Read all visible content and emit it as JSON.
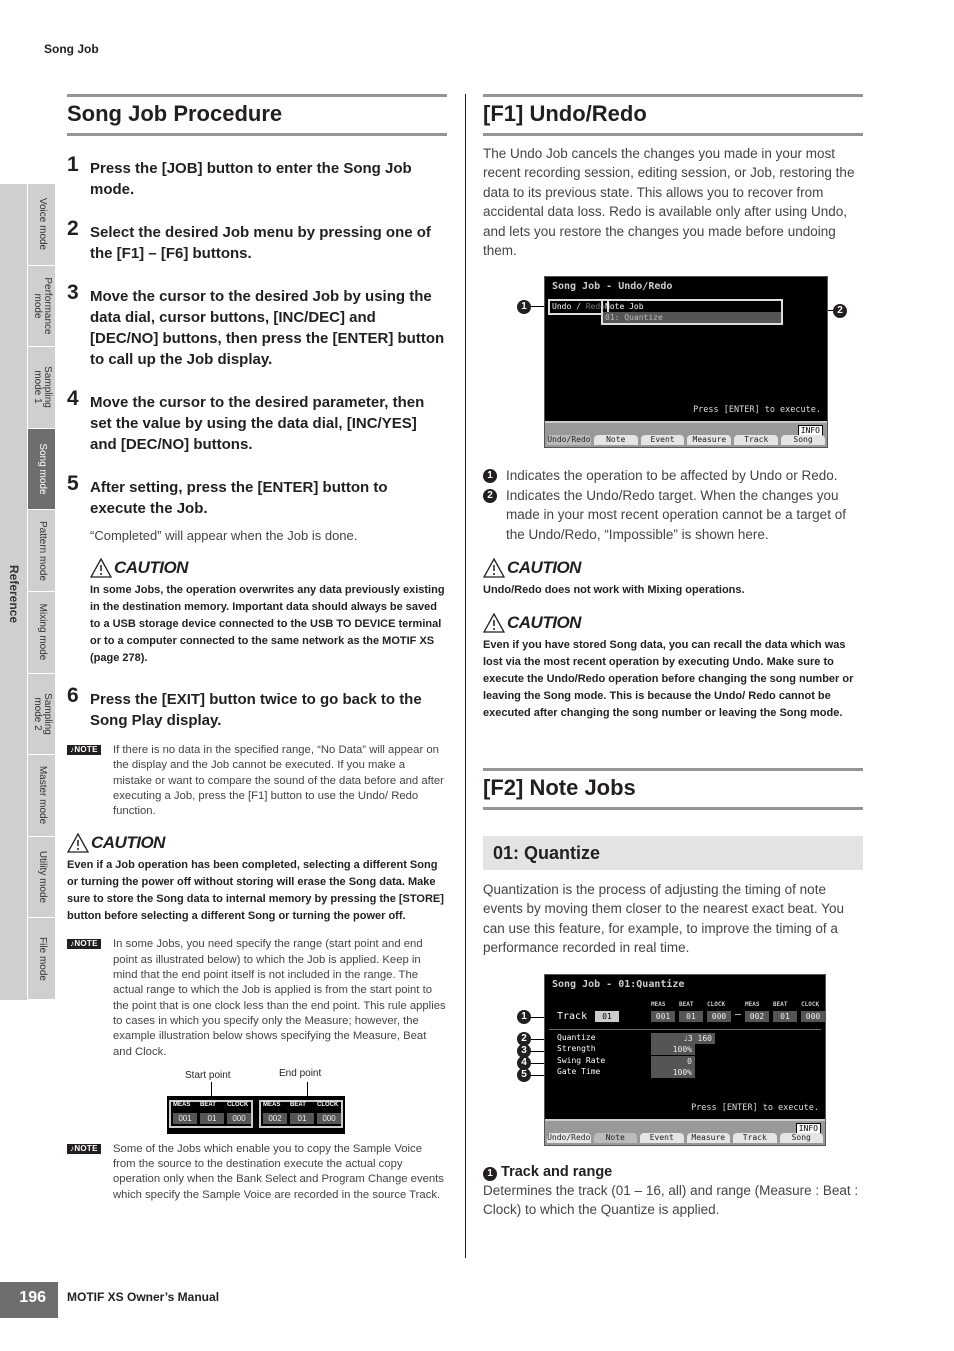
{
  "header": {
    "section": "Song Job"
  },
  "sidebar": {
    "group_label": "Reference",
    "tabs": [
      {
        "label": "Voice mode",
        "active": false
      },
      {
        "label": "Performance\nmode",
        "active": false
      },
      {
        "label": "Sampling\nmode 1",
        "active": false
      },
      {
        "label": "Song mode",
        "active": true
      },
      {
        "label": "Pattern mode",
        "active": false
      },
      {
        "label": "Mixing mode",
        "active": false
      },
      {
        "label": "Sampling\nmode 2",
        "active": false
      },
      {
        "label": "Master mode",
        "active": false
      },
      {
        "label": "Utility mode",
        "active": false
      },
      {
        "label": "File mode",
        "active": false
      }
    ]
  },
  "left": {
    "title": "Song Job Procedure",
    "steps": [
      {
        "num": "1",
        "text": "Press the [JOB] button to enter the Song Job mode."
      },
      {
        "num": "2",
        "text": "Select the desired Job menu by pressing one of the [F1] – [F6] buttons."
      },
      {
        "num": "3",
        "text": "Move the cursor to the desired Job by using the data dial, cursor buttons, [INC/DEC] and [DEC/NO] buttons, then press the [ENTER] button to call up the Job display."
      },
      {
        "num": "4",
        "text": "Move the cursor to the desired parameter, then set the value by using the data dial, [INC/YES] and [DEC/NO] buttons."
      },
      {
        "num": "5",
        "text": "After setting, press the [ENTER] button to execute the Job."
      },
      {
        "num": "6",
        "text": "Press the [EXIT] button twice to go back to the Song Play display."
      }
    ],
    "step5_sub": "“Completed” will appear when the Job is done.",
    "caution_label": "CAUTION",
    "caution1": "In some Jobs, the operation overwrites any data previously existing in the destination memory. Important data should always be saved to a USB storage device connected to the USB TO DEVICE terminal or to a computer connected to the same network as the MOTIF XS (page 278).",
    "note_label": "NOTE",
    "note1": "If there is no data in the specified range, “No Data” will appear on the display and the Job cannot be executed. If you make a mistake or want to compare the sound of the data before and after executing a Job, press the [F1] button to use the Undo/ Redo function.",
    "caution2": "Even if a Job operation has been completed, selecting a different Song or turning the power off without storing will erase the Song data. Make sure to store the Song data to internal memory by pressing the [STORE] button before selecting a different Song or turning the power off.",
    "note2": "In some Jobs, you need specify the range (start point and end point as illustrated below) to which the Job is applied. Keep in mind that the end point itself is not included in the range. The actual range to which the Job is applied is from the start point to the point that is one clock less than the end point. This rule applies to cases in which you specify only the Measure; however, the example illustration below shows specifying the Measure, Beat and Clock.",
    "range_fig": {
      "start_label": "Start point",
      "end_label": "End point",
      "headers": [
        "MEAS",
        "BEAT",
        "CLOCK"
      ],
      "start": [
        "001",
        "01",
        "000"
      ],
      "end": [
        "002",
        "01",
        "000"
      ]
    },
    "note3": "Some of the Jobs which enable you to copy the Sample Voice from the source to the destination execute the actual copy operation only when the Bank Select and Program Change events which specify the Sample Voice are recorded in the source Track."
  },
  "right": {
    "undo_title": "[F1] Undo/Redo",
    "undo_body": "The Undo Job cancels the changes you made in your most recent recording session, editing session, or Job, restoring the data to its previous state. This allows you to recover from accidental data loss. Redo is available only after using Undo, and lets you restore the changes you made before undoing them.",
    "undo_screen": {
      "title": "Song Job - Undo/Redo",
      "undo": "Undo",
      "slash": " / ",
      "redo": "Redo",
      "job_name": "Note Job",
      "job_item": "01: Quantize",
      "press": "Press [ENTER] to execute.",
      "info": "INFO",
      "tabs": [
        "Undo/Redo",
        "Note",
        "Event",
        "Measure",
        "Track",
        "Song"
      ],
      "active_tab": 0
    },
    "undo_callouts": [
      "1",
      "2"
    ],
    "undo_items": [
      {
        "num": "1",
        "text": "Indicates the operation to be affected by Undo or Redo."
      },
      {
        "num": "2",
        "text": "Indicates the Undo/Redo target. When the changes you made in your most recent operation cannot be a target of the Undo/Redo, “Impossible” is shown here."
      }
    ],
    "caution_label": "CAUTION",
    "caution1": "Undo/Redo does not work with Mixing operations.",
    "caution2": "Even if you have stored Song data, you can recall the data which was lost via the most recent operation by executing Undo. Make sure to execute the Undo/Redo operation before changing the song number or leaving the Song mode. This is because the Undo/ Redo cannot be executed after changing the song number or leaving the Song mode.",
    "note_title": "[F2] Note Jobs",
    "quantize_title": "01: Quantize",
    "quantize_body": "Quantization is the process of adjusting the timing of note events by moving them closer to the nearest exact beat. You can use this feature, for example, to improve the timing of a performance recorded in real time.",
    "quantize_screen": {
      "title": "Song Job - 01:Quantize",
      "track_label": "Track",
      "track_value": "01",
      "headers": [
        "MEAS",
        "BEAT",
        "CLOCK"
      ],
      "start": [
        "001",
        "01",
        "000"
      ],
      "end": [
        "002",
        "01",
        "000"
      ],
      "params": [
        {
          "label": "Quantize",
          "value": "♩3 160"
        },
        {
          "label": "Strength",
          "value": "100%"
        },
        {
          "label": "Swing Rate",
          "value": "0"
        },
        {
          "label": "Gate Time",
          "value": "100%"
        }
      ],
      "press": "Press [ENTER] to execute.",
      "info": "INFO",
      "tabs": [
        "Undo/Redo",
        "Note",
        "Event",
        "Measure",
        "Track",
        "Song"
      ],
      "active_tab": 1
    },
    "quantize_callouts": [
      "1",
      "2",
      "3",
      "4",
      "5"
    ],
    "track_range_num": "1",
    "track_range_title": "Track and range",
    "track_range_body": "Determines the track (01 – 16, all) and range (Measure : Beat : Clock) to which the Quantize is applied."
  },
  "footer": {
    "page": "196",
    "manual": "MOTIF XS Owner’s Manual"
  }
}
